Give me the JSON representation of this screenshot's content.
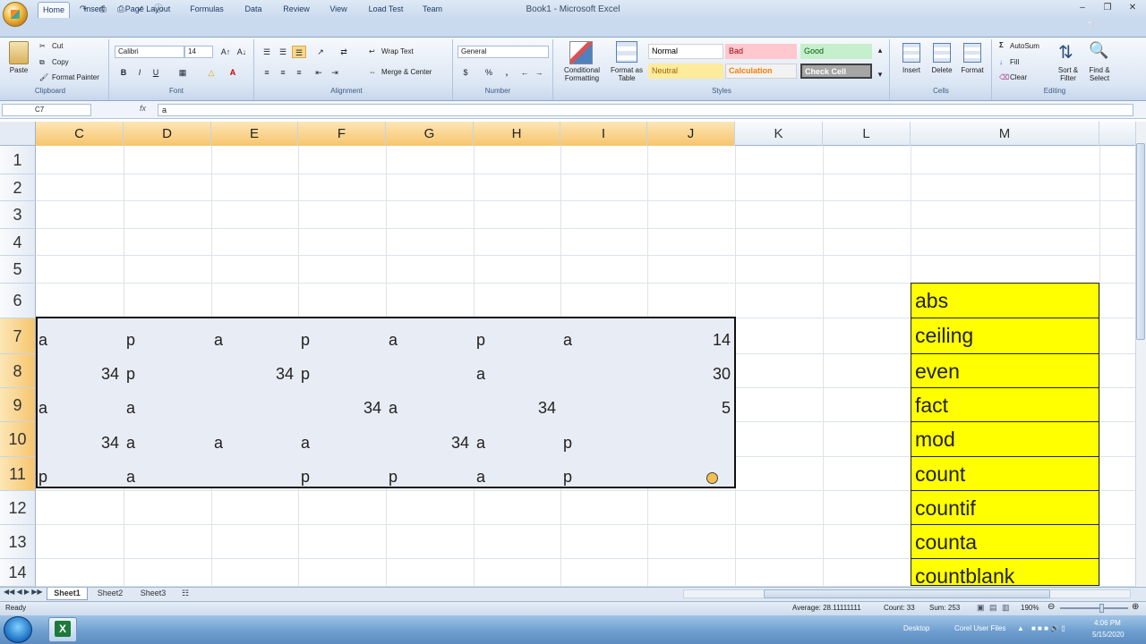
{
  "window": {
    "title": "Book1 - Microsoft Excel"
  },
  "tabs": [
    {
      "label": "Home",
      "active": true
    },
    {
      "label": "Insert"
    },
    {
      "label": "Page Layout"
    },
    {
      "label": "Formulas"
    },
    {
      "label": "Data"
    },
    {
      "label": "Review"
    },
    {
      "label": "View"
    },
    {
      "label": "Load Test"
    },
    {
      "label": "Team"
    }
  ],
  "ribbon": {
    "clipboard": {
      "label": "Clipboard",
      "paste": "Paste",
      "cut": "Cut",
      "copy": "Copy",
      "format_painter": "Format Painter"
    },
    "font": {
      "label": "Font",
      "name": "Calibri",
      "size": "14",
      "bold": "B",
      "italic": "I",
      "underline": "U"
    },
    "alignment": {
      "label": "Alignment",
      "wrap_text": "Wrap Text",
      "merge_center": "Merge & Center"
    },
    "number": {
      "label": "Number",
      "format": "General",
      "currency": "$",
      "percent": "%",
      "comma": ","
    },
    "styles": {
      "label": "Styles",
      "conditional": "Conditional Formatting",
      "format_table": "Format as Table",
      "cells": [
        {
          "label": "Normal",
          "bg": "#ffffff",
          "fg": "#000000"
        },
        {
          "label": "Bad",
          "bg": "#ffc7ce",
          "fg": "#9c0006"
        },
        {
          "label": "Good",
          "bg": "#c6efce",
          "fg": "#006100"
        },
        {
          "label": "Neutral",
          "bg": "#ffeb9c",
          "fg": "#9c6500"
        },
        {
          "label": "Calculation",
          "bg": "#f2f2f2",
          "fg": "#fa7d00"
        },
        {
          "label": "Check Cell",
          "bg": "#a5a5a5",
          "fg": "#ffffff"
        }
      ]
    },
    "cells": {
      "label": "Cells",
      "insert": "Insert",
      "delete": "Delete",
      "format": "Format"
    },
    "editing": {
      "label": "Editing",
      "autosum": "AutoSum",
      "fill": "Fill",
      "clear": "Clear",
      "sort_filter": "Sort & Filter",
      "find_select": "Find & Select"
    }
  },
  "formula_bar": {
    "name_box": "C7",
    "fx": "fx",
    "value": "a"
  },
  "columns": [
    "C",
    "D",
    "E",
    "F",
    "G",
    "H",
    "I",
    "J",
    "K",
    "L",
    "M"
  ],
  "selected_columns": [
    "C",
    "D",
    "E",
    "F",
    "G",
    "H",
    "I",
    "J"
  ],
  "rows": [
    "1",
    "2",
    "3",
    "4",
    "5",
    "6",
    "7",
    "8",
    "9",
    "10",
    "11",
    "12",
    "13",
    "14"
  ],
  "selected_rows": [
    "7",
    "8",
    "9",
    "10",
    "11"
  ],
  "grid": {
    "row7": {
      "C": "a",
      "D": "p",
      "E": "a",
      "F": "p",
      "G": "a",
      "H": "p",
      "I": "a",
      "J": "14"
    },
    "row8": {
      "C": "34",
      "D": "p",
      "E": "34",
      "F": "p",
      "H": "a",
      "J": "30"
    },
    "row9": {
      "C": "a",
      "D": "a",
      "F": "34",
      "G": "a",
      "H": "34",
      "J": "5"
    },
    "row10": {
      "C": "34",
      "D": "a",
      "E": "a",
      "F": "a",
      "G": "34",
      "H": "a",
      "I": "p"
    },
    "row11": {
      "C": "p",
      "D": "a",
      "F": "p",
      "G": "p",
      "H": "a",
      "I": "p"
    }
  },
  "function_list": [
    "abs",
    "ceiling",
    "even",
    "fact",
    "mod",
    "count",
    "countif",
    "counta",
    "countblank"
  ],
  "function_list_color": "#ffff00",
  "sheets": [
    {
      "label": "Sheet1",
      "active": true
    },
    {
      "label": "Sheet2"
    },
    {
      "label": "Sheet3"
    }
  ],
  "status": {
    "ready": "Ready",
    "average": "Average: 28.11111111",
    "count": "Count: 33",
    "sum": "Sum: 253",
    "zoom": "190%"
  },
  "taskbar": {
    "desktop": "Desktop",
    "corel": "Corel User Files",
    "time": "4:06 PM",
    "date": "5/15/2020"
  }
}
